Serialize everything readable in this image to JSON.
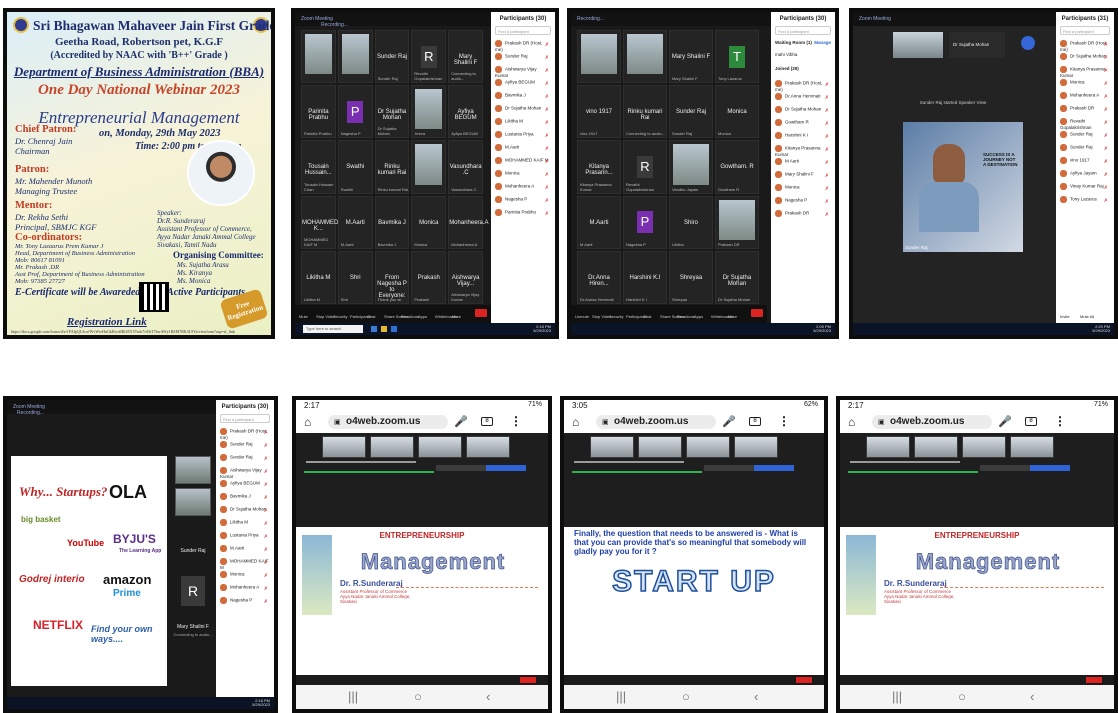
{
  "poster": {
    "college": "Sri Bhagawan Mahaveer Jain First Grade College",
    "address": "Geetha Road, Robertson pet, K.G.F",
    "accreditation": "(Accredited by NAAC with 'B++' Grade )",
    "department": "Department of Business Administration (BBA)",
    "webinar": "One Day National Webinar 2023",
    "on": "on",
    "theme": "Entrepreneurial Management",
    "date": "on, Monday, 29th May 2023",
    "time": "Time: 2:00 pm to 3:00 pm",
    "chief_patron_label": "Chief Patron:",
    "chief_patron": "Dr. Chenraj Jain\nChairman",
    "patron_label": "Patron:",
    "patron": "Mr. Mahender Munoth\nManaging Trustee",
    "mentor_label": "Mentor:",
    "mentor": "Dr. Rekha Sethi\nPrincipal, SBMJC KGF",
    "coord_label": "Co-ordinators:",
    "coord": "Mr. Tony Lazaarus Prem Kumar J\nHead, Department of Business Administration\nMob: 80617 81091\nMr. Prakash .DR\nAsst Prof, Department of Business Administration\nMob: 97385 27727",
    "speaker": "Speaker:\nDr.R. Sunderaraj\nAssistant Professor of Commerce,\nAyya Nadar Janaki Ammal College\nSivakasi, Tamil Nadu",
    "org_label": "Organising Committee:",
    "org": "Ms. Sujatha Arasu\nMs. Kiranya\nMs. Monica",
    "certificate": "E-Certificate will be Awareded to All Active Participants",
    "registration": "Registration Link",
    "free_badge": "Free Registration",
    "reg_url": "https://docs.google.com/forms/d/e/1FAIpQLScxfWvWwHnGkHwd4Ri3EX5Tmk7vMrT7bwAWy1BZM7RK3L9Ya/viewform?usp=sf_link"
  },
  "zoom_gallery_1": {
    "title": "Zoom Meeting",
    "recording": "Recording...",
    "participants_header": "Participants (30)",
    "search": "Find a participant",
    "tiles": [
      {
        "name": "",
        "sub": "",
        "photo": true
      },
      {
        "name": "",
        "sub": "",
        "photo": true
      },
      {
        "name": "Sunder Raj",
        "sub": "Sunder Raj"
      },
      {
        "name": "R",
        "sub": "Revathi Gopalakrishnan",
        "avatar": "#3a3a3a"
      },
      {
        "name": "Mary Shalini F",
        "sub": "Connecting to audio..."
      },
      {
        "name": "Parinita Prabhu",
        "sub": "Parinita Prabhu"
      },
      {
        "name": "P",
        "sub": "Nagesha P",
        "avatar": "#7a2fb0"
      },
      {
        "name": "Dr Sujatha Mohan",
        "sub": "Dr Sujatha Mohan"
      },
      {
        "name": "",
        "sub": "Jeeva",
        "photo": true
      },
      {
        "name": "Ayfiya BEGUM",
        "sub": "Ayfiya BEGUM"
      },
      {
        "name": "Tousain Hussain...",
        "sub": "Tousain Hussain Chan"
      },
      {
        "name": "Swathi",
        "sub": "Swathi"
      },
      {
        "name": "Rinku kumari Rai",
        "sub": "Rinku kumari Rai"
      },
      {
        "name": "",
        "sub": "",
        "photo": true
      },
      {
        "name": "Vasundhara .C",
        "sub": "Vasundhara C"
      },
      {
        "name": "MOHAMMED K...",
        "sub": "MOHAMMED KAIF M"
      },
      {
        "name": "M.Aarti",
        "sub": "M.Aarti"
      },
      {
        "name": "Bavmika J",
        "sub": "Bavmika J"
      },
      {
        "name": "Monica",
        "sub": "Monica"
      },
      {
        "name": "Mohanheera.A",
        "sub": "Mohanheera A"
      },
      {
        "name": "Likitha M",
        "sub": "Likitha M"
      },
      {
        "name": "Shri",
        "sub": "Shri"
      },
      {
        "name": "From Nagesha P to Everyone:",
        "sub": "Thank you sir"
      },
      {
        "name": "Prakash",
        "sub": "Prakash"
      },
      {
        "name": "Aishwarya Vijay...",
        "sub": "Aishwarya Vijay Kumar"
      }
    ],
    "participants": [
      "Prakash DR (Host, me)",
      "Sunder Raj",
      "Aishwarya Vijay Kumar",
      "Ayfiya BEGUM",
      "Bavmika J",
      "Dr Sujatha Mohan",
      "Likitha M",
      "Lustania Priya",
      "M.Aarti",
      "MOHAMMED KAIF M",
      "Monica",
      "Mohanheera A",
      "Nagesha P",
      "Parinita Prabhu"
    ],
    "controls": [
      "Mute",
      "Stop Video",
      "Security",
      "Participants",
      "Chat",
      "Share Screen",
      "Reactions",
      "Apps",
      "Whiteboards",
      "More"
    ],
    "end": "End",
    "taskbar_search": "Type here to search",
    "clock": "2:18 PM\n5/29/2023"
  },
  "zoom_gallery_2": {
    "title": "Recording...",
    "participants_header": "Participants (30)",
    "search": "Find a participant",
    "waiting_room": "Waiting Room (1)",
    "waiting_user": "mahi Vibha",
    "admit": "Manage",
    "joined": "Joined (29)",
    "tiles": [
      {
        "name": "",
        "sub": "",
        "photo": true
      },
      {
        "name": "",
        "sub": "",
        "photo": true
      },
      {
        "name": "Mary Shalini F",
        "sub": "Mary Shalini F"
      },
      {
        "name": "T",
        "sub": "Tony Lazarus",
        "avatar": "#2d8a3c"
      },
      {
        "name": "vino 1917",
        "sub": "vino 1917"
      },
      {
        "name": "Rinku kumari Rai",
        "sub": "Connecting to audio..."
      },
      {
        "name": "Sunder Raj",
        "sub": "Sunder Raj"
      },
      {
        "name": "Monica",
        "sub": "Monica"
      },
      {
        "name": "Kitanya Prasann...",
        "sub": "Kitanya Prasanna Kumar"
      },
      {
        "name": "R",
        "sub": "Revathi Gopalakrishnan",
        "avatar": "#3a3a3a"
      },
      {
        "name": "",
        "sub": "Vandhu Jayam",
        "photo": true
      },
      {
        "name": "Gowtham. R",
        "sub": "Gowtham R"
      },
      {
        "name": "M.Aarti",
        "sub": "M Aarti"
      },
      {
        "name": "P",
        "sub": "Nagesha P",
        "avatar": "#7a2fb0"
      },
      {
        "name": "Shiro",
        "sub": "Likitha"
      },
      {
        "name": "",
        "sub": "Prakash DR",
        "photo": true
      },
      {
        "name": "Dr.Anna Hiren...",
        "sub": "Dr.Annas Hemmati"
      },
      {
        "name": "Harshini K.I",
        "sub": "Harshini K I"
      },
      {
        "name": "Shreyaa",
        "sub": "Shreyaa"
      },
      {
        "name": "Dr Sujatha Mohan",
        "sub": "Dr Sujatha Mohan"
      }
    ],
    "participants": [
      "Prakash DR (Host, me)",
      "Dr.Anna Hemmati",
      "Dr Sujatha Mohan",
      "Gowtham R",
      "Harshini K I",
      "Kitanya Prasanna Kumar",
      "M Aarti",
      "Mary Shalini F",
      "Monica",
      "Nagesha P",
      "Prakash DR"
    ],
    "controls": [
      "Unmute",
      "Stop Video",
      "Security",
      "Participants",
      "Chat",
      "Share Screen",
      "Reactions",
      "Apps",
      "Whiteboards",
      "More"
    ],
    "end": "End",
    "clock": "2:05 PM\n5/29/2023"
  },
  "zoom_speaker": {
    "title": "Zoom Meeting",
    "banner": "Sunder Raj started Speaker View",
    "speaker_name": "Sunder Raj",
    "book_text": "SUCCESS IS A JOURNEY NOT A DESTINATION",
    "participants_header": "Participants (31)",
    "search": "Find a participant",
    "participants": [
      "Prakash DR (Host, me)",
      "Dr Sujatha Mohan",
      "Kitanya Prasanna Kumar",
      "Monica",
      "Mohanheera A",
      "Prakash DR",
      "Revathi Gopalakrishnan",
      "Sunder Raj",
      "Sunder Raj",
      "vino 1917",
      "Ayfiya Jayam",
      "Vinay Kumar Raj",
      "Tony Lazarus"
    ],
    "buttons": [
      "Invite",
      "Mute All"
    ],
    "clock": "2:20 PM\n5/29/2023"
  },
  "zoom_share": {
    "title": "Zoom Meeting",
    "recording": "Recording...",
    "slide_heading": "Why... Startups?",
    "brands": [
      "OLA",
      "big basket",
      "YouTube",
      "BYJU'S",
      "The Learning App",
      "Godrej interio",
      "amazon",
      "Prime",
      "NETFLIX"
    ],
    "slide_footer": "Find your own ways....",
    "strip": [
      {
        "name": "Sunder Raj",
        "sub": "Sunder Raj"
      },
      {
        "name": "R",
        "sub": "Revathi Gopalakrishnan..."
      },
      {
        "name": "Mary Shalini F",
        "sub": "Connecting to audio..."
      }
    ],
    "participants_header": "Participants (30)",
    "search": "Find a participant",
    "participants": [
      "Prakash DR (Host, me)",
      "Sunder Raj",
      "Sunder Raj",
      "Aishwarya Vijay Kumar",
      "Ayfiya BEGUM",
      "Bavmika J",
      "Dr Sujatha Mohan",
      "Likitha M",
      "Lustania Priya",
      "M.Aarti",
      "MOHAMMED KAIF M",
      "Monica",
      "Mohanheera A",
      "Nagesha P"
    ],
    "clock": "2:18 PM\n5/29/2023"
  },
  "mobile_1": {
    "time": "2:17",
    "battery": "71%",
    "url": "o4web.zoom.us",
    "tab_count": "8",
    "slide_title": "ENTREPRENEURSHIP",
    "slide_big": "Management",
    "slide_speaker": "Dr. R.Sunderaraj",
    "slide_sub": "Assistant Professor of Commerce\nAyya Nadar Janaki Ammal College,\nSivakasi"
  },
  "mobile_2": {
    "time": "3:05",
    "battery": "62%",
    "url": "o4web.zoom.us",
    "tab_count": "8",
    "question": "Finally, the question that needs to be answered is - What is that you can provide that's so meaningful that somebody will gladly pay you for it ?",
    "start": "START UP"
  },
  "mobile_3": {
    "time": "2:17",
    "battery": "71%",
    "url": "o4web.zoom.us",
    "tab_count": "8",
    "slide_title": "ENTREPRENEURSHIP",
    "slide_big": "Management",
    "slide_speaker": "Dr. R.Sunderaraj",
    "slide_sub": "Assistant Professor of Commerce\nAyya Nadar Janaki Ammal College,\nSivakasi"
  },
  "colors": {
    "end_red": "#dd2222",
    "zoom_dark": "#1a1a1a",
    "poster_title": "#1f2d6e",
    "accent_orange": "#c8452a"
  }
}
